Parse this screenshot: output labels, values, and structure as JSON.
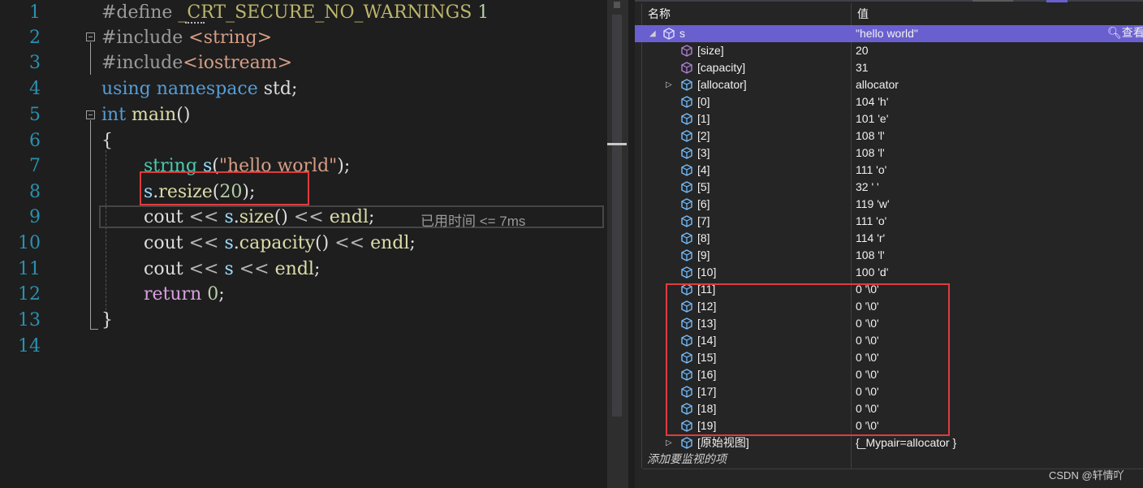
{
  "editor": {
    "line_numbers": [
      "1",
      "2",
      "3",
      "4",
      "5",
      "6",
      "7",
      "8",
      "9",
      "10",
      "11",
      "12",
      "13",
      "14"
    ],
    "perf_tip": "已用时间 <= 7ms"
  },
  "watch": {
    "columns": {
      "name": "名称",
      "value": "值"
    },
    "root": {
      "name": "s",
      "value": "\"hello world\"",
      "view_label": "查看"
    },
    "rows": [
      {
        "name": "[size]",
        "value": "20"
      },
      {
        "name": "[capacity]",
        "value": "31"
      },
      {
        "name": "[allocator]",
        "value": "allocator"
      },
      {
        "name": "[0]",
        "value": "104 'h'"
      },
      {
        "name": "[1]",
        "value": "101 'e'"
      },
      {
        "name": "[2]",
        "value": "108 'l'"
      },
      {
        "name": "[3]",
        "value": "108 'l'"
      },
      {
        "name": "[4]",
        "value": "111 'o'"
      },
      {
        "name": "[5]",
        "value": "32 ' '"
      },
      {
        "name": "[6]",
        "value": "119 'w'"
      },
      {
        "name": "[7]",
        "value": "111 'o'"
      },
      {
        "name": "[8]",
        "value": "114 'r'"
      },
      {
        "name": "[9]",
        "value": "108 'l'"
      },
      {
        "name": "[10]",
        "value": "100 'd'"
      },
      {
        "name": "[11]",
        "value": "0 '\\0'"
      },
      {
        "name": "[12]",
        "value": "0 '\\0'"
      },
      {
        "name": "[13]",
        "value": "0 '\\0'"
      },
      {
        "name": "[14]",
        "value": "0 '\\0'"
      },
      {
        "name": "[15]",
        "value": "0 '\\0'"
      },
      {
        "name": "[16]",
        "value": "0 '\\0'"
      },
      {
        "name": "[17]",
        "value": "0 '\\0'"
      },
      {
        "name": "[18]",
        "value": "0 '\\0'"
      },
      {
        "name": "[19]",
        "value": "0 '\\0'"
      },
      {
        "name": "[原始视图]",
        "value": "{_Mypair=allocator }"
      }
    ],
    "add_watch_placeholder": "添加要监视的项"
  },
  "watermark": "CSDN @轩情吖",
  "colors": {
    "selection": "#6a5fcf",
    "highlight_box": "#e03c3c",
    "line_number": "#2b91af"
  }
}
